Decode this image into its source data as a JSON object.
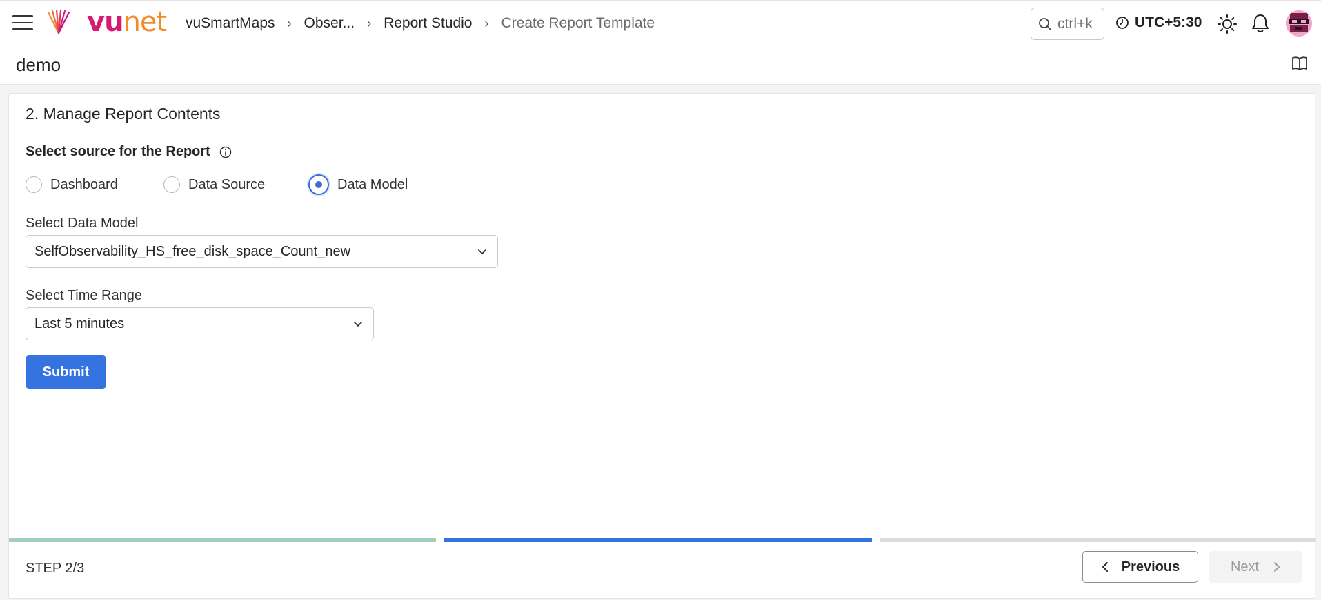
{
  "header": {
    "logo_text_vu": "vu",
    "logo_text_net": "net",
    "breadcrumb": [
      "vuSmartMaps",
      "Obser...",
      "Report Studio",
      "Create Report Template"
    ],
    "search_placeholder": "ctrl+k",
    "timezone": "UTC+5:30",
    "icons": [
      "menu-icon",
      "search-icon",
      "clock-icon",
      "sun-icon",
      "bell-icon",
      "book-icon",
      "info-icon"
    ]
  },
  "page": {
    "title": "demo"
  },
  "section": {
    "title": "2. Manage Report Contents",
    "source_label": "Select source for the Report",
    "source_options": [
      "Dashboard",
      "Data Source",
      "Data Model"
    ],
    "selected_source": "Data Model",
    "data_model_label": "Select Data Model",
    "data_model_value": "SelfObservability_HS_free_disk_space_Count_new",
    "time_range_label": "Select Time Range",
    "time_range_value": "Last 5 minutes",
    "submit_label": "Submit"
  },
  "stepper": {
    "step_text": "STEP 2/3",
    "current_step": 2,
    "total_steps": 3,
    "colors": {
      "done": "#a3cdbf",
      "active": "#3574e0",
      "pending": "#dcdcdc"
    },
    "previous_label": "Previous",
    "next_label": "Next"
  }
}
